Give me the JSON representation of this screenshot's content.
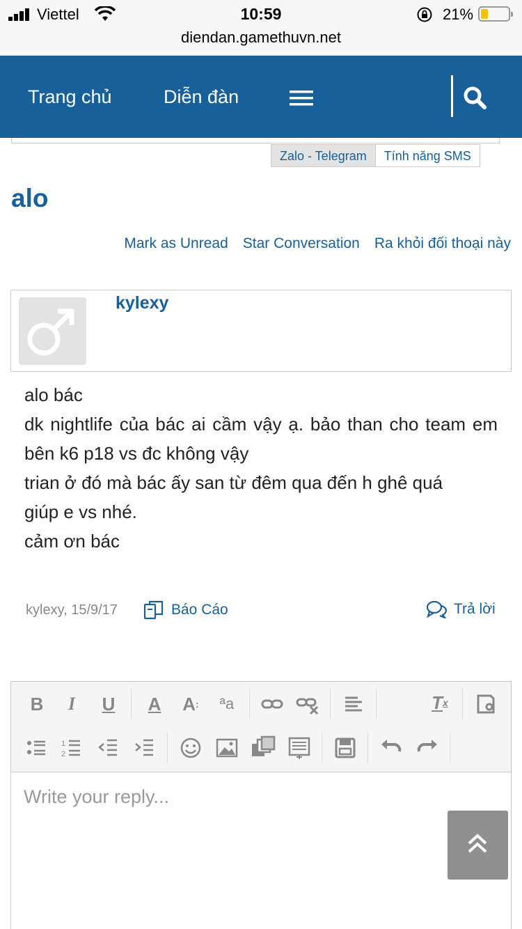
{
  "status_bar": {
    "carrier": "Viettel",
    "time": "10:59",
    "battery_percent": "21%",
    "battery_level": 0.21
  },
  "browser": {
    "url": "diendan.gamethuvn.net"
  },
  "nav": {
    "home": "Trang chủ",
    "forum": "Diễn đàn"
  },
  "subtabs": [
    "Zalo - Telegram",
    "Tính năng SMS"
  ],
  "conversation": {
    "title": "alo",
    "actions": [
      "Mark as Unread",
      "Star Conversation",
      "Ra khỏi đối thoại này"
    ]
  },
  "post": {
    "username": "kylexy",
    "lines": [
      "alo bác",
      "dk nightlife của bác ai cầm vậy ạ. bảo than cho team em bên k6 p18 vs đc không vậy",
      "trian ở đó mà bác ấy san từ đêm qua đến h ghê quá",
      "giúp e vs nhé.",
      "cảm ơn bác"
    ],
    "meta": "kylexy, 15/9/17",
    "report_label": "Báo Cáo",
    "reply_label": "Trả lời"
  },
  "editor": {
    "placeholder": "Write your reply..."
  },
  "colors": {
    "brand": "#17609a",
    "nav_bg": "#17609a"
  }
}
